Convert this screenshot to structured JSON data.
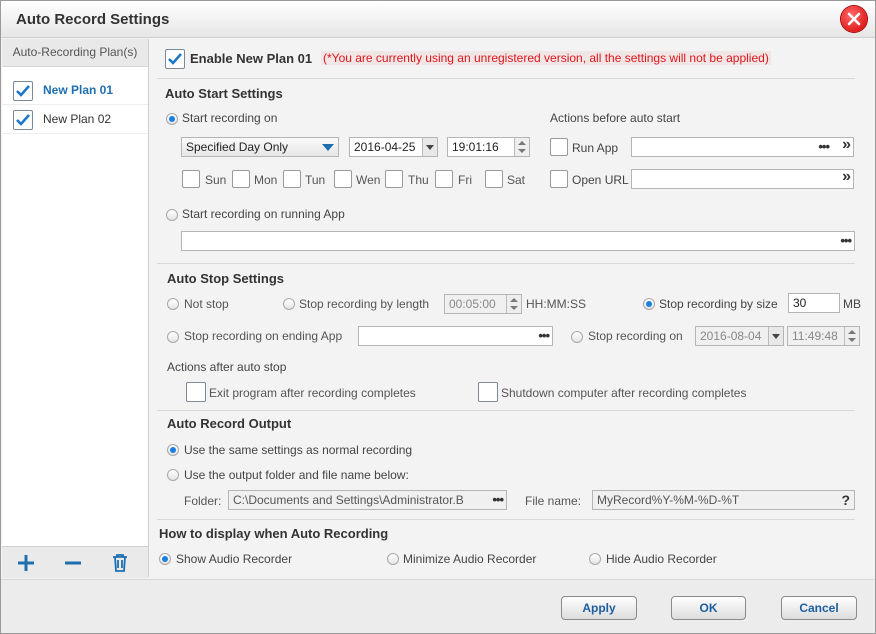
{
  "window": {
    "title": "Auto Record Settings"
  },
  "plans": {
    "header": "Auto-Recording Plan(s)",
    "items": [
      {
        "label": "New Plan 01",
        "checked": true,
        "selected": true
      },
      {
        "label": "New Plan 02",
        "checked": true,
        "selected": false
      }
    ]
  },
  "enable": {
    "label": "Enable New Plan 01",
    "warning": "(*You are currently using an unregistered version, all the settings will not be applied)"
  },
  "auto_start": {
    "title": "Auto Start Settings",
    "start_on_label": "Start recording on",
    "mode_value": "Specified Day Only",
    "date": "2016-04-25",
    "time": "19:01:16",
    "days": [
      "Sun",
      "Mon",
      "Tun",
      "Wen",
      "Thu",
      "Fri",
      "Sat"
    ],
    "running_app_label": "Start recording on running App",
    "running_app_path": "",
    "actions_title": "Actions before auto start",
    "run_app_label": "Run App",
    "run_app_value": "",
    "open_url_label": "Open URL",
    "open_url_value": ""
  },
  "auto_stop": {
    "title": "Auto Stop Settings",
    "not_stop": "Not stop",
    "by_length": "Stop recording by length",
    "length_value": "00:05:00",
    "length_unit": "HH:MM:SS",
    "by_size": "Stop recording by size",
    "size_value": "30",
    "size_unit": "MB",
    "ending_app": "Stop recording on ending App",
    "ending_app_value": "",
    "stop_on": "Stop recording on",
    "stop_date": "2016-08-04",
    "stop_time": "11:49:48",
    "actions_after_title": "Actions after auto stop",
    "exit_program": "Exit program after recording completes",
    "shutdown": "Shutdown computer after recording completes"
  },
  "output": {
    "title": "Auto Record Output",
    "same_settings": "Use the same settings as normal recording",
    "custom": "Use the output folder and file name below:",
    "folder_label": "Folder:",
    "folder_value": "C:\\Documents and Settings\\Administrator.B",
    "filename_label": "File name:",
    "filename_value": "MyRecord%Y-%M-%D-%T",
    "help_glyph": "?"
  },
  "display": {
    "title": "How to display when Auto Recording",
    "show": "Show Audio Recorder",
    "minimize": "Minimize Audio Recorder",
    "hide": "Hide Audio Recorder"
  },
  "buttons": {
    "apply": "Apply",
    "ok": "OK",
    "cancel": "Cancel"
  },
  "glyphs": {
    "dots": "•••",
    "go": "»"
  },
  "colors": {
    "accent": "#1a80e0",
    "warning": "#e0151b",
    "link": "#1e5fa0"
  }
}
